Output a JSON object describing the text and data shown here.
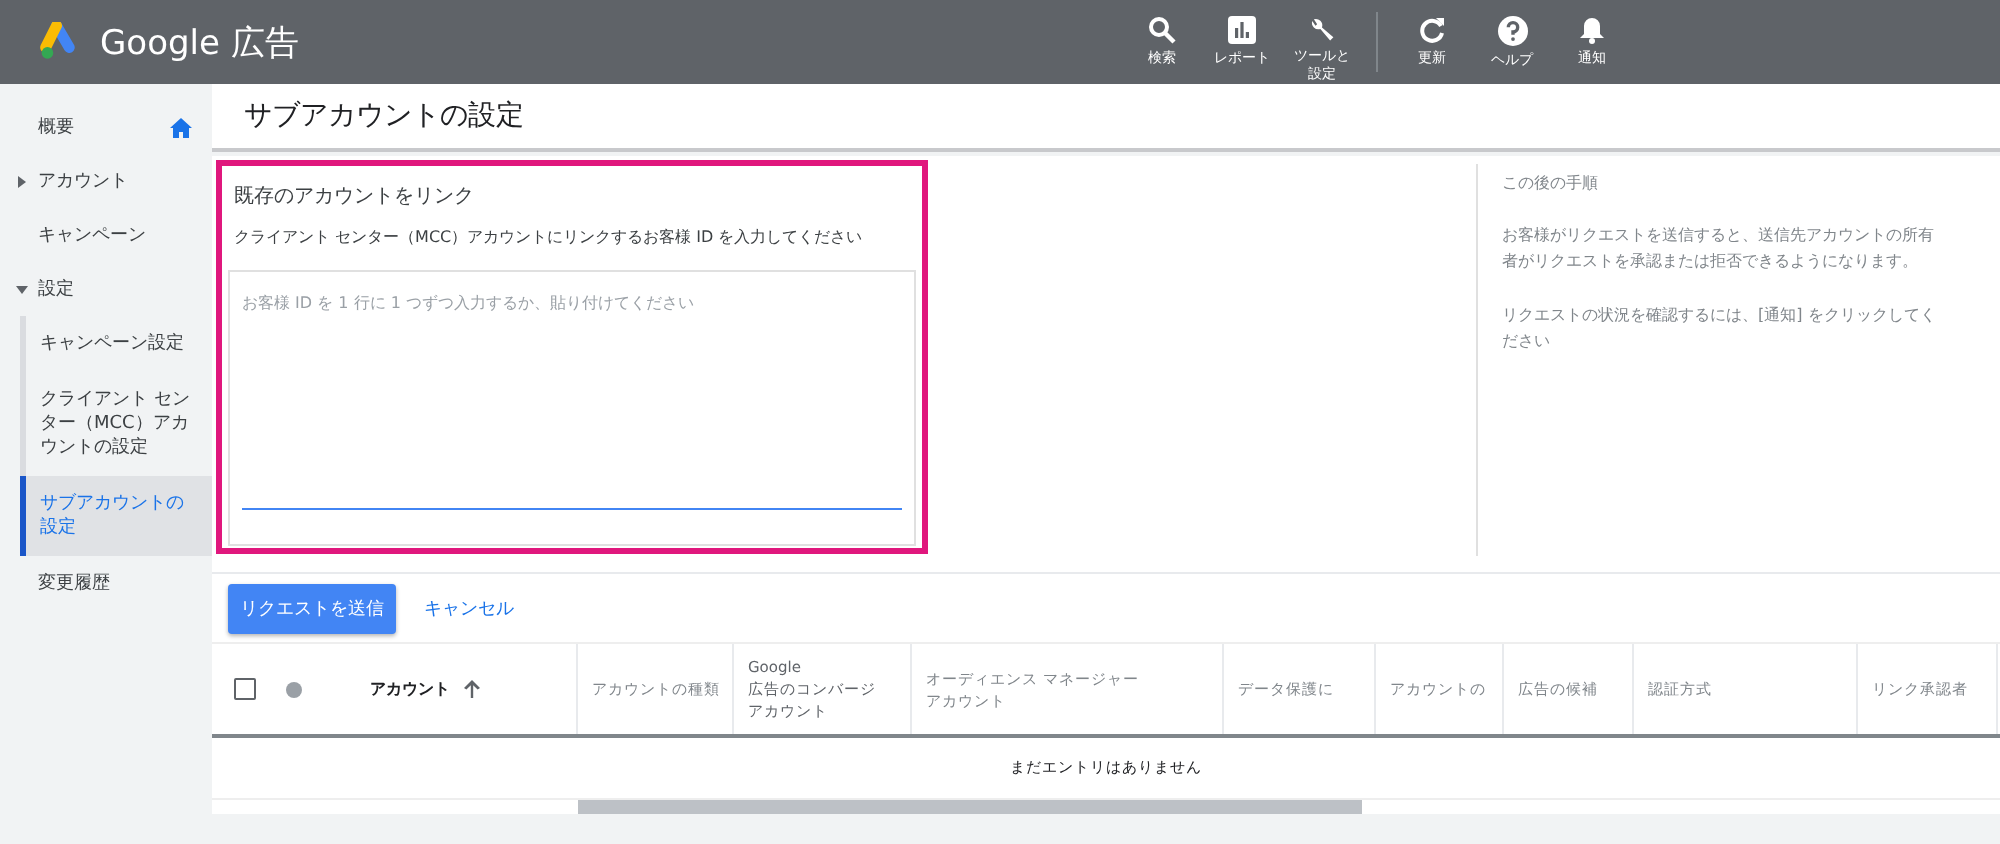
{
  "header": {
    "brand": "Google 広告",
    "tools": [
      {
        "kind": "search",
        "label": "検索"
      },
      {
        "kind": "report",
        "label": "レポート"
      },
      {
        "kind": "tools",
        "label": "ツールと設定"
      },
      {
        "kind": "refresh",
        "label": "更新"
      },
      {
        "kind": "help",
        "label": "ヘルプ"
      },
      {
        "kind": "bell",
        "label": "通知"
      }
    ]
  },
  "sidebar": {
    "items": [
      {
        "label": "概要",
        "selected": false,
        "home": true
      },
      {
        "label": "アカウント",
        "selected": false,
        "expanded": false
      },
      {
        "label": "キャンペーン",
        "selected": false
      },
      {
        "label": "設定",
        "selected": false,
        "expanded": true,
        "children": [
          {
            "label": "キャンペーン設定",
            "selected": false
          },
          {
            "label": "クライアント センター（MCC）アカウントの設定",
            "selected": false
          },
          {
            "label": "サブアカウントの設定",
            "selected": true
          }
        ]
      },
      {
        "label": "変更履歴",
        "selected": false
      }
    ]
  },
  "page_title": "サブアカウントの設定",
  "link_form": {
    "title": "既存のアカウントをリンク",
    "instruction": "クライアント センター（MCC）アカウントにリンクするお客様 ID を入力してください",
    "placeholder": "お客様 ID を 1 行に 1 つずつ入力するか、貼り付けてください"
  },
  "next_steps": {
    "title": "この後の手順",
    "paragraphs": [
      "お客様がリクエストを送信すると、送信先アカウントの所有者がリクエストを承認または拒否できるようになります。",
      "リクエストの状況を確認するには、[通知] をクリックしてください"
    ]
  },
  "buttons": {
    "submit": "リクエストを送信",
    "cancel": "キャンセル"
  },
  "table": {
    "select_all_checked": false,
    "columns": [
      {
        "lines": [
          "アカウント"
        ]
      },
      {
        "lines": [
          "アカウントの種類"
        ]
      },
      {
        "lines": [
          "Google",
          "広告のコンバージ",
          "アカウント"
        ]
      },
      {
        "lines": [
          "オーディエンス マネージャー",
          "アカウント"
        ]
      },
      {
        "lines": [
          "データ保護に"
        ]
      },
      {
        "lines": [
          "アカウントの"
        ]
      },
      {
        "lines": [
          "広告の候補"
        ]
      },
      {
        "lines": [
          "認証方式"
        ]
      },
      {
        "lines": [
          "リンク承認者"
        ]
      }
    ],
    "empty_message": "まだエントリはありません"
  }
}
